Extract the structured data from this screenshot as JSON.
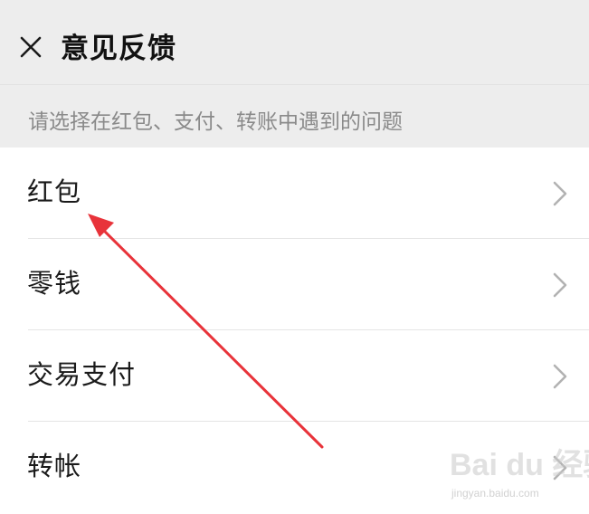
{
  "header": {
    "title": "意见反馈",
    "close_icon": "close-icon"
  },
  "hint": {
    "text": "请选择在红包、支付、转账中遇到的问题"
  },
  "list": {
    "items": [
      {
        "label": "红包",
        "icon": "chevron-right-icon"
      },
      {
        "label": "零钱",
        "icon": "chevron-right-icon"
      },
      {
        "label": "交易支付",
        "icon": "chevron-right-icon"
      },
      {
        "label": "转帐",
        "icon": "chevron-right-icon"
      }
    ]
  },
  "annotation": {
    "arrow_color": "#e8333a"
  },
  "watermark": {
    "logo": "Bai du 经验",
    "url": "jingyan.baidu.com"
  },
  "colors": {
    "background": "#ededed",
    "list_background": "#ffffff",
    "hint_text": "#8a8a8a",
    "title_text": "#111111",
    "chevron": "#b2b2b2"
  }
}
